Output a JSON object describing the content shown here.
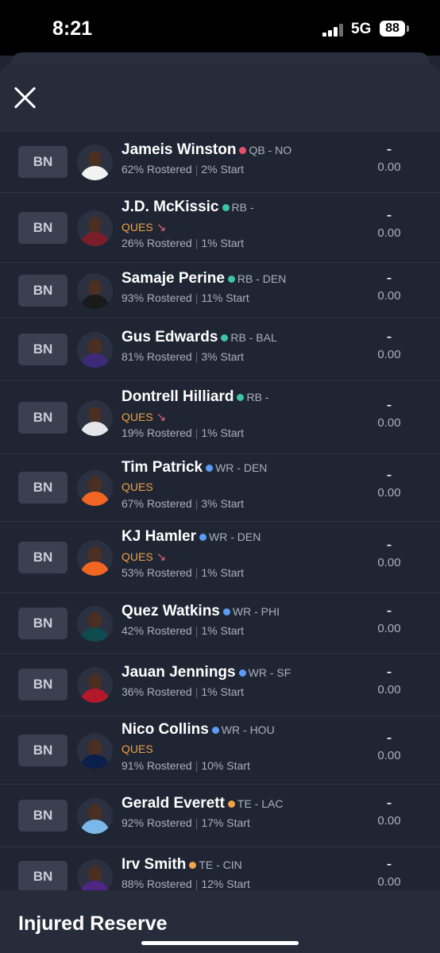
{
  "status_bar": {
    "time": "8:21",
    "network": "5G",
    "battery": "88"
  },
  "header": {
    "close_icon": "close-icon"
  },
  "players": [
    {
      "slot": "BN",
      "name": "Jameis Winston",
      "dot_color": "#e8506e",
      "pos": "QB - NO",
      "status": "",
      "trend": false,
      "rostered": "62% Rostered",
      "start": "2% Start",
      "proj": "-",
      "pts": "0.00",
      "jersey": "#f2f2f2"
    },
    {
      "slot": "BN",
      "name": "J.D. McKissic",
      "dot_color": "#3cc7a4",
      "pos": "RB -",
      "status": "QUES",
      "trend": true,
      "rostered": "26% Rostered",
      "start": "1% Start",
      "proj": "-",
      "pts": "0.00",
      "jersey": "#7a1f2a"
    },
    {
      "slot": "BN",
      "name": "Samaje Perine",
      "dot_color": "#3cc7a4",
      "pos": "RB - DEN",
      "status": "",
      "trend": false,
      "rostered": "93% Rostered",
      "start": "11% Start",
      "proj": "-",
      "pts": "0.00",
      "jersey": "#1a1a1a"
    },
    {
      "slot": "BN",
      "name": "Gus Edwards",
      "dot_color": "#3cc7a4",
      "pos": "RB - BAL",
      "status": "",
      "trend": false,
      "rostered": "81% Rostered",
      "start": "3% Start",
      "proj": "-",
      "pts": "0.00",
      "jersey": "#3d2a78"
    },
    {
      "slot": "BN",
      "name": "Dontrell Hilliard",
      "dot_color": "#3cc7a4",
      "pos": "RB -",
      "status": "QUES",
      "trend": true,
      "rostered": "19% Rostered",
      "start": "1% Start",
      "proj": "-",
      "pts": "0.00",
      "jersey": "#e6e6ea"
    },
    {
      "slot": "BN",
      "name": "Tim Patrick",
      "dot_color": "#5b9cf5",
      "pos": "WR - DEN",
      "status": "QUES",
      "trend": false,
      "rostered": "67% Rostered",
      "start": "3% Start",
      "proj": "-",
      "pts": "0.00",
      "jersey": "#f26522"
    },
    {
      "slot": "BN",
      "name": "KJ Hamler",
      "dot_color": "#5b9cf5",
      "pos": "WR - DEN",
      "status": "QUES",
      "trend": true,
      "rostered": "53% Rostered",
      "start": "1% Start",
      "proj": "-",
      "pts": "0.00",
      "jersey": "#f26522"
    },
    {
      "slot": "BN",
      "name": "Quez Watkins",
      "dot_color": "#5b9cf5",
      "pos": "WR - PHI",
      "status": "",
      "trend": false,
      "rostered": "42% Rostered",
      "start": "1% Start",
      "proj": "-",
      "pts": "0.00",
      "jersey": "#0e4a4e"
    },
    {
      "slot": "BN",
      "name": "Jauan Jennings",
      "dot_color": "#5b9cf5",
      "pos": "WR - SF",
      "status": "",
      "trend": false,
      "rostered": "36% Rostered",
      "start": "1% Start",
      "proj": "-",
      "pts": "0.00",
      "jersey": "#b3192a"
    },
    {
      "slot": "BN",
      "name": "Nico Collins",
      "dot_color": "#5b9cf5",
      "pos": "WR - HOU",
      "status": "QUES",
      "trend": false,
      "rostered": "91% Rostered",
      "start": "10% Start",
      "proj": "-",
      "pts": "0.00",
      "jersey": "#0b1f4b"
    },
    {
      "slot": "BN",
      "name": "Gerald Everett",
      "dot_color": "#f2a24a",
      "pos": "TE - LAC",
      "status": "",
      "trend": false,
      "rostered": "92% Rostered",
      "start": "17% Start",
      "proj": "-",
      "pts": "0.00",
      "jersey": "#79b8e8"
    },
    {
      "slot": "BN",
      "name": "Irv Smith",
      "dot_color": "#f2a24a",
      "pos": "TE - CIN",
      "status": "",
      "trend": false,
      "rostered": "88% Rostered",
      "start": "12% Start",
      "proj": "-",
      "pts": "0.00",
      "jersey": "#4f2683"
    }
  ],
  "section": {
    "title": "Injured Reserve"
  },
  "icons": {
    "trend_arrow": "arrow-down-right-icon",
    "signal": "signal-icon",
    "battery": "battery-icon"
  }
}
